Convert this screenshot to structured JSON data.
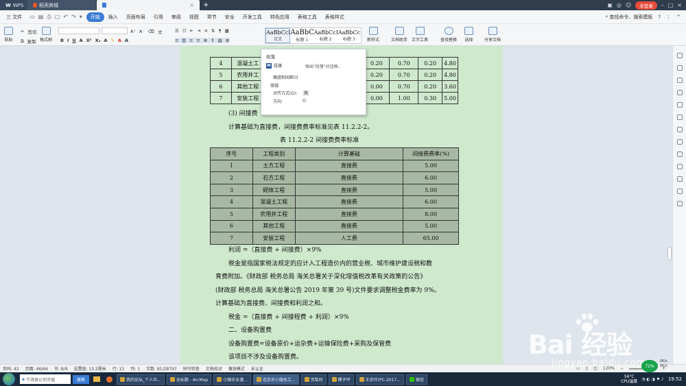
{
  "titlebar": {
    "app_name": "WPS",
    "tabs": [
      {
        "label": "稻壳商城"
      },
      {
        "label": ""
      }
    ],
    "login": "未登录"
  },
  "menubar": {
    "file": "三 文件",
    "tabs": [
      "开始",
      "插入",
      "页面布局",
      "引用",
      "审阅",
      "视图",
      "章节",
      "安全",
      "开发工具",
      "特色应用",
      "表格工具",
      "表格样式"
    ],
    "search": "查找命令、搜索模板"
  },
  "ribbon": {
    "paste": "粘贴",
    "cut": "剪切",
    "copy": "复制",
    "format_painter": "格式刷",
    "styles": [
      {
        "sample": "AaBbCcDd",
        "name": "正文"
      },
      {
        "sample": "AaBbC",
        "name": "标题 1"
      },
      {
        "sample": "AaBbCcI",
        "name": "标题 2"
      },
      {
        "sample": "AaBbCc",
        "name": "标题 3"
      }
    ],
    "new_style": "新样式",
    "doc_assistant": "文档助手",
    "text_tools": "文字工具",
    "find_replace": "查找替换",
    "select": "选择",
    "share": "分享文档"
  },
  "popup": {
    "title": "段落",
    "paragraph": "段落",
    "paragraph_desc": "弹出\"段落\"对话框。",
    "indent": "缩进和间距(I)",
    "general": "常规",
    "alignment": "对齐方式(G):",
    "alignment_value": "两",
    "direction": "方向:"
  },
  "table1": {
    "rows": [
      [
        "4",
        "混凝土工",
        "0.20",
        "0.70",
        "0.20",
        "4.80"
      ],
      [
        "5",
        "农用井工",
        "0.20",
        "0.70",
        "0.20",
        "4.80"
      ],
      [
        "6",
        "其他工程",
        "0.00",
        "0.70",
        "0.20",
        "3.60"
      ],
      [
        "7",
        "安装工程",
        "0.00",
        "1.00",
        "0.30",
        "5.00"
      ]
    ]
  },
  "doc": {
    "l1": "(3) 间接费",
    "l2": "计算基础为直接费，间接费费率标准见表 11.2.2-2。",
    "caption": "表 11.2.2-2      间接费费率标准",
    "l3": "利润 =（直接费 + 间接费）×9%",
    "l4": "税金是指国家税法规定的应计入工程造价内的营业税、城市维护建设税和教",
    "l5": "育费附加。《财政部 税务总局 海关总署关于深化增值税改革有关政策的公告》",
    "l6": "(财政部 税务总局 海关总署公告 2019 年第 39 号)文件要求调整税金费率为 9%。",
    "l7": "计算基础为直接费、间接费和利润之和。",
    "l8": "税金 =（直接费 + 间接程费 + 利润）×9%",
    "l9": "二、设备购置费",
    "l10": "设备购置费=设备原价+运杂费+运输保险费+采购及保管费",
    "l11": "该项目不涉及设备购置费。"
  },
  "table2": {
    "header": [
      "序号",
      "工程类别",
      "计算基础",
      "间接费费率(%)"
    ],
    "rows": [
      [
        "1",
        "土方工程",
        "直接费",
        "5.00"
      ],
      [
        "2",
        "石方工程",
        "直接费",
        "6.00"
      ],
      [
        "3",
        "砌体工程",
        "直接费",
        "5.00"
      ],
      [
        "4",
        "混凝土工程",
        "直接费",
        "6.00"
      ],
      [
        "5",
        "农用井工程",
        "直接费",
        "8.00"
      ],
      [
        "6",
        "其他工程",
        "直接费",
        "5.00"
      ],
      [
        "7",
        "安装工程",
        "人工费",
        "65.00"
      ]
    ]
  },
  "statusbar": {
    "page": "页码: 42",
    "pages": "页面: 46/64",
    "section": "节: 8/9",
    "setting": "设置值: 13.2厘米",
    "row": "行: 15",
    "col": "列: 1",
    "words": "字数: 81/28797",
    "spell": "拼写检查",
    "proof": "文档校对",
    "compat": "兼容模式",
    "cert": "未认证",
    "zoom": "120%"
  },
  "taskbar": {
    "search_text": "宁洱身公司市值",
    "search_btn": "搜索",
    "items": [
      "我的论坛_个人中...",
      "无标题 - ArcMap",
      "小微农业灌...",
      "北京市小微水工...",
      "茨梨村",
      "椰子坪",
      "王庆玲(PC-2017...",
      "微信"
    ],
    "temp": "56°C",
    "cpu": "CPU温度",
    "time": "19:52"
  },
  "watermark": {
    "brand": "Bai  经验",
    "url": "jingyan.baidu.com"
  },
  "widget": {
    "percent": "72%",
    "up": "0K/s",
    "down": "0K/s"
  },
  "colors": {
    "page_bg": "#cfe9cd",
    "table_bg": "#a7b9a3",
    "accent": "#3a7bd5"
  }
}
